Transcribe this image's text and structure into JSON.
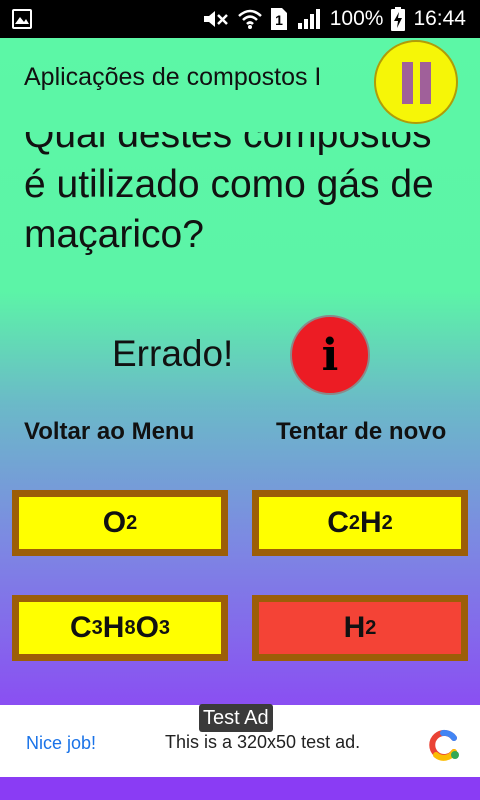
{
  "status_bar": {
    "battery": "100%",
    "time": "16:44",
    "sim_slot": "1",
    "icons": [
      "image-icon",
      "mute-icon",
      "wifi-icon",
      "sim-icon",
      "signal-icon",
      "battery-charging-icon"
    ]
  },
  "header": {
    "title": "Aplicações de compostos I",
    "pause_icon": "pause-icon"
  },
  "question": {
    "text": "Qual destes compostos é utilizado como gás de maçarico?"
  },
  "feedback": {
    "result": "Errado!",
    "info_label": "i"
  },
  "links": {
    "menu": "Voltar ao Menu",
    "retry": "Tentar de novo"
  },
  "answers": [
    {
      "parts": [
        [
          "O",
          ""
        ],
        [
          "2",
          "sub"
        ]
      ],
      "state": "normal"
    },
    {
      "parts": [
        [
          "C",
          ""
        ],
        [
          "2",
          "sub"
        ],
        [
          "H",
          ""
        ],
        [
          "2",
          "sub"
        ]
      ],
      "state": "normal"
    },
    {
      "parts": [
        [
          "C",
          ""
        ],
        [
          "3",
          "sub"
        ],
        [
          "H",
          ""
        ],
        [
          "8",
          "sub"
        ],
        [
          "O",
          ""
        ],
        [
          "3",
          "sub"
        ]
      ],
      "state": "normal"
    },
    {
      "parts": [
        [
          "H",
          ""
        ],
        [
          "2",
          "sub"
        ]
      ],
      "state": "wrong"
    }
  ],
  "ad": {
    "badge": "Test Ad",
    "left_text": "Nice job!",
    "main_text": "This is a 320x50 test ad."
  },
  "colors": {
    "answer_normal": "#ffff00",
    "answer_wrong": "#f44336",
    "answer_border": "#9c5e08",
    "pause_button": "#f6f607",
    "info_button": "#ec1c24"
  }
}
